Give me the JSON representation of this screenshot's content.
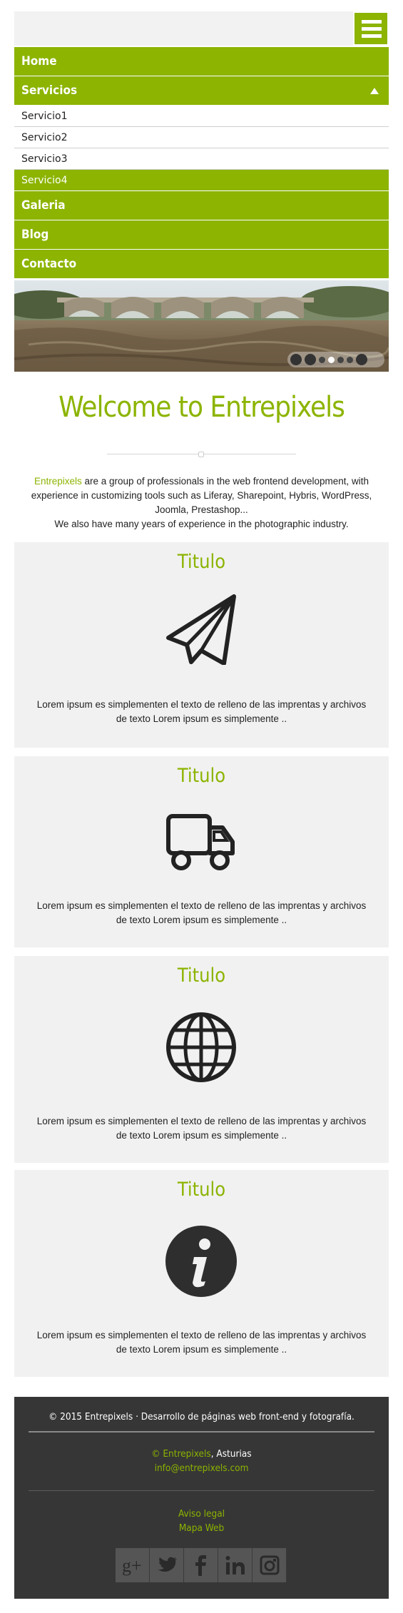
{
  "nav": {
    "home": "Home",
    "servicios": "Servicios",
    "sub": [
      "Servicio1",
      "Servicio2",
      "Servicio3",
      "Servicio4"
    ],
    "galeria": "Galeria",
    "blog": "Blog",
    "contacto": "Contacto"
  },
  "welcome": {
    "title": "Welcome to Entrepixels",
    "brand": "Entrepixels",
    "line1": " are a group of professionals in the web frontend development, with experience in customizing tools such as Liferay, Sharepoint, Hybris, WordPress, Joomla, Prestashop...",
    "line2": "We also have many years of experience in the photographic industry."
  },
  "cards": [
    {
      "title": "Titulo",
      "icon": "paper-plane-icon",
      "text": "Lorem ipsum es simplementen el texto de relleno de las imprentas y archivos de texto Lorem ipsum es simplemente .."
    },
    {
      "title": "Titulo",
      "icon": "truck-icon",
      "text": "Lorem ipsum es simplementen el texto de relleno de las imprentas y archivos de texto Lorem ipsum es simplemente .."
    },
    {
      "title": "Titulo",
      "icon": "globe-icon",
      "text": "Lorem ipsum es simplementen el texto de relleno de las imprentas y archivos de texto Lorem ipsum es simplemente .."
    },
    {
      "title": "Titulo",
      "icon": "info-icon",
      "text": "Lorem ipsum es simplementen el texto de relleno de las imprentas y archivos de texto Lorem ipsum es simplemente .."
    }
  ],
  "footer": {
    "copyright": "© 2015 Entrepixels · Desarrollo de páginas web front-end y fotografía.",
    "company": "© Entrepixels",
    "location": ", Asturias",
    "email": "info@entrepixels.com",
    "legal": "Aviso legal",
    "sitemap": "Mapa Web",
    "social": [
      "google-plus-icon",
      "twitter-icon",
      "facebook-icon",
      "linkedin-icon",
      "instagram-icon"
    ]
  },
  "colors": {
    "accent": "#8cb400",
    "footer_bg": "#363636",
    "card_bg": "#f1f1f1"
  }
}
